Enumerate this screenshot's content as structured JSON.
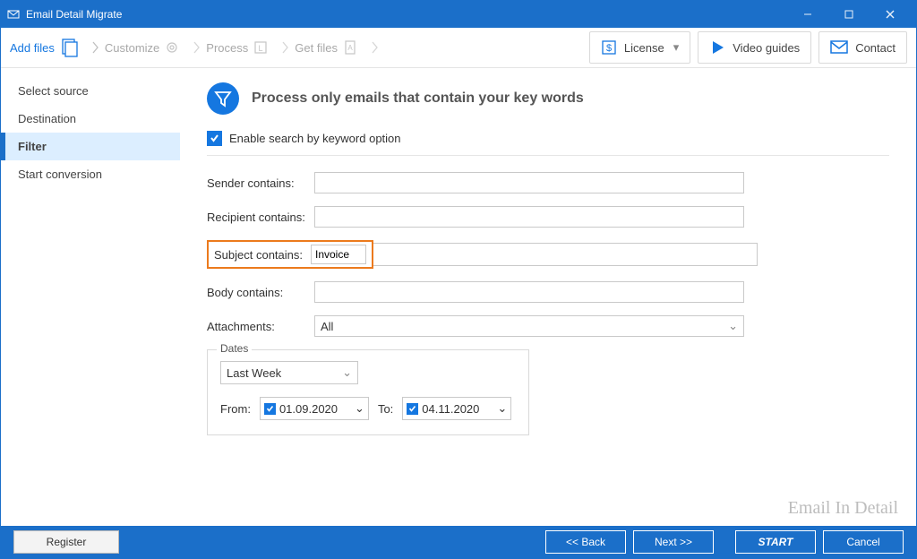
{
  "titlebar": {
    "title": "Email Detail Migrate"
  },
  "breadcrumb": [
    {
      "label": "Add files",
      "active": true
    },
    {
      "label": "Customize",
      "active": false
    },
    {
      "label": "Process",
      "active": false
    },
    {
      "label": "Get files",
      "active": false
    }
  ],
  "top_buttons": {
    "license": "License",
    "video": "Video guides",
    "contact": "Contact"
  },
  "sidebar": {
    "items": [
      {
        "label": "Select source",
        "selected": false
      },
      {
        "label": "Destination",
        "selected": false
      },
      {
        "label": "Filter",
        "selected": true
      },
      {
        "label": "Start conversion",
        "selected": false
      }
    ]
  },
  "header": {
    "title": "Process only emails that contain your key words"
  },
  "enable_checkbox": {
    "label": "Enable search by keyword option",
    "checked": true
  },
  "form": {
    "sender_label": "Sender contains:",
    "sender_value": "",
    "recipient_label": "Recipient contains:",
    "recipient_value": "",
    "subject_label": "Subject contains:",
    "subject_value": "Invoice",
    "body_label": "Body contains:",
    "body_value": "",
    "attachments_label": "Attachments:",
    "attachments_value": "All"
  },
  "dates": {
    "legend": "Dates",
    "preset": "Last Week",
    "from_label": "From:",
    "from_value": "01.09.2020",
    "from_checked": true,
    "to_label": "To:",
    "to_value": "04.11.2020",
    "to_checked": true
  },
  "watermark": "Email In Detail",
  "footer": {
    "register": "Register",
    "back": "<<  Back",
    "next": "Next  >>",
    "start": "START",
    "cancel": "Cancel"
  },
  "colors": {
    "accent": "#1b6fc9",
    "highlight": "#ec7a1d"
  }
}
